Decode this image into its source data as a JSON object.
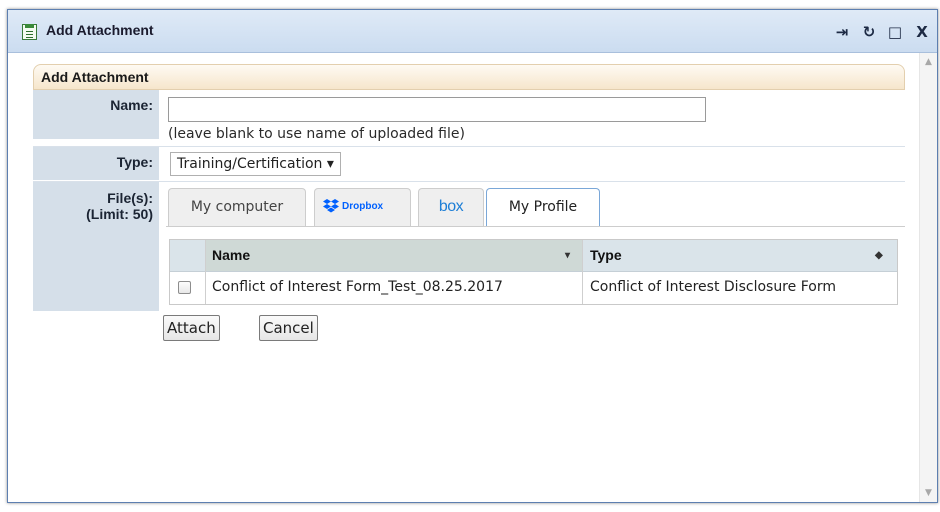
{
  "window": {
    "title": "Add Attachment",
    "controls": {
      "pin": "⇥",
      "refresh": "↻",
      "maximize": "□",
      "close": "X"
    }
  },
  "section": {
    "title": "Add Attachment"
  },
  "form": {
    "name_label": "Name:",
    "name_value": "",
    "name_hint": "(leave blank to use name of uploaded file)",
    "type_label": "Type:",
    "type_selected": "Training/Certification ▾",
    "files_label_line1": "File(s):",
    "files_label_line2": "(Limit: 50)"
  },
  "tabs": [
    {
      "label": "My computer",
      "icon": "computer"
    },
    {
      "label": "Dropbox",
      "icon": "dropbox-icon"
    },
    {
      "label": "box",
      "icon": "box-icon"
    },
    {
      "label": "My Profile",
      "icon": "profile",
      "active": true
    }
  ],
  "grid": {
    "columns": [
      {
        "label": "Name",
        "sort": "▾"
      },
      {
        "label": "Type",
        "sort": "◆"
      }
    ],
    "rows": [
      {
        "checked": false,
        "name": "Conflict of Interest Form_Test_08.25.2017",
        "type": "Conflict of Interest Disclosure Form"
      }
    ]
  },
  "buttons": {
    "attach": "Attach",
    "cancel": "Cancel"
  },
  "colors": {
    "title_bar": "#cbdcf0",
    "label_column": "#d5dfe9",
    "section_header": "#f6e6cc",
    "active_tab_border": "#7aa7d8",
    "dropbox_blue": "#0061fe",
    "box_blue": "#1e7fd6"
  }
}
